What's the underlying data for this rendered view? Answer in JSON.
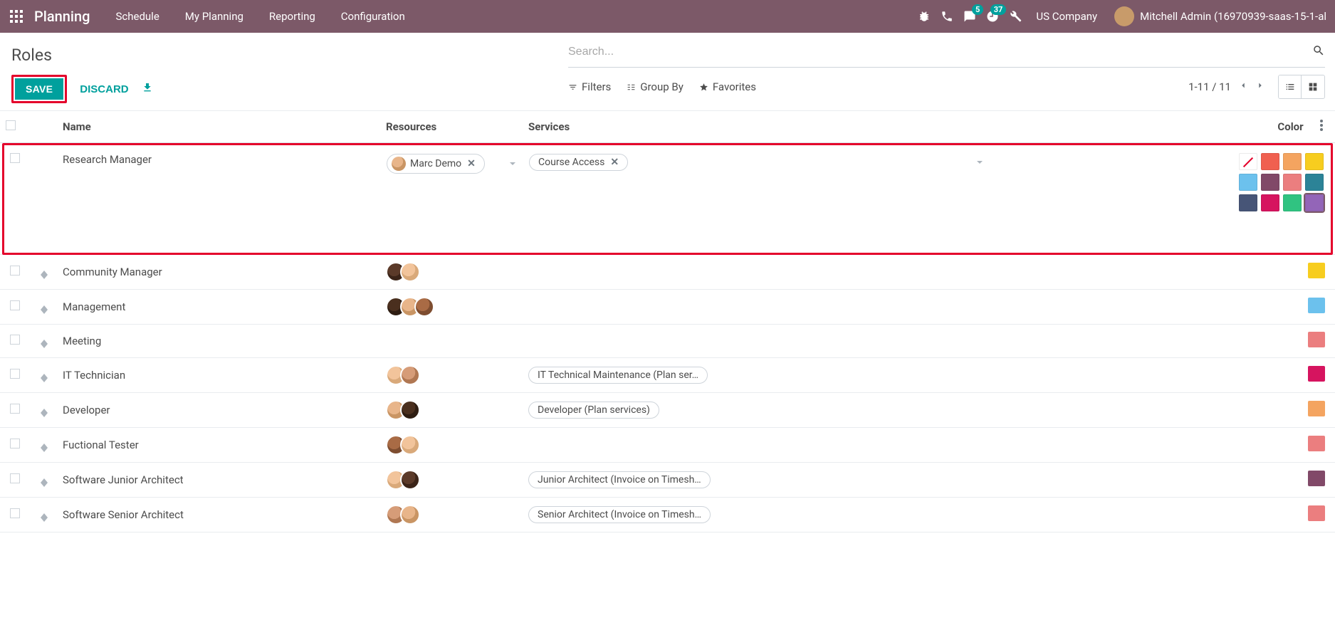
{
  "nav": {
    "brand": "Planning",
    "items": [
      "Schedule",
      "My Planning",
      "Reporting",
      "Configuration"
    ],
    "messaging_badge": "5",
    "activity_badge": "37",
    "company": "US Company",
    "user": "Mitchell Admin (16970939-saas-15-1-al"
  },
  "control": {
    "breadcrumb": "Roles",
    "save": "SAVE",
    "discard": "DISCARD",
    "search_placeholder": "Search...",
    "filters": "Filters",
    "groupby": "Group By",
    "favorites": "Favorites",
    "pager": "1-11 / 11"
  },
  "columns": {
    "name": "Name",
    "resources": "Resources",
    "services": "Services",
    "color": "Color"
  },
  "edit_row": {
    "name": "Research Manager",
    "resource_tag": "Marc Demo",
    "service_tag": "Course Access"
  },
  "palette_colors": [
    [
      "none",
      "#f06050",
      "#f4a460",
      "#f7cd1f"
    ],
    [
      "#6cc1ed",
      "#814968",
      "#eb7e7f",
      "#2c8397"
    ],
    [
      "#475577",
      "#d6145f",
      "#30c381",
      "#9365b8"
    ]
  ],
  "palette_selected": "#9365b8",
  "rows": [
    {
      "name": "Community Manager",
      "avatars": [
        "a1",
        "a2"
      ],
      "service": "",
      "color": "#f7cd1f"
    },
    {
      "name": "Management",
      "avatars": [
        "a3",
        "a4",
        "a5"
      ],
      "service": "",
      "color": "#6cc1ed"
    },
    {
      "name": "Meeting",
      "avatars": [],
      "service": "",
      "color": "#eb7e7f"
    },
    {
      "name": "IT Technician",
      "avatars": [
        "a2",
        "a6"
      ],
      "service": "IT Technical Maintenance (Plan ser…",
      "color": "#d6145f"
    },
    {
      "name": "Developer",
      "avatars": [
        "a4",
        "a3"
      ],
      "service": "Developer (Plan services)",
      "color": "#f4a460"
    },
    {
      "name": "Fuctional Tester",
      "avatars": [
        "a5",
        "a2"
      ],
      "service": "",
      "color": "#eb7e7f"
    },
    {
      "name": "Software Junior Architect",
      "avatars": [
        "a2",
        "a1"
      ],
      "service": "Junior Architect (Invoice on Timesh…",
      "color": "#814968"
    },
    {
      "name": "Software Senior Architect",
      "avatars": [
        "a6",
        "a4"
      ],
      "service": "Senior Architect (Invoice on Timesh…",
      "color": "#eb7e7f"
    }
  ]
}
